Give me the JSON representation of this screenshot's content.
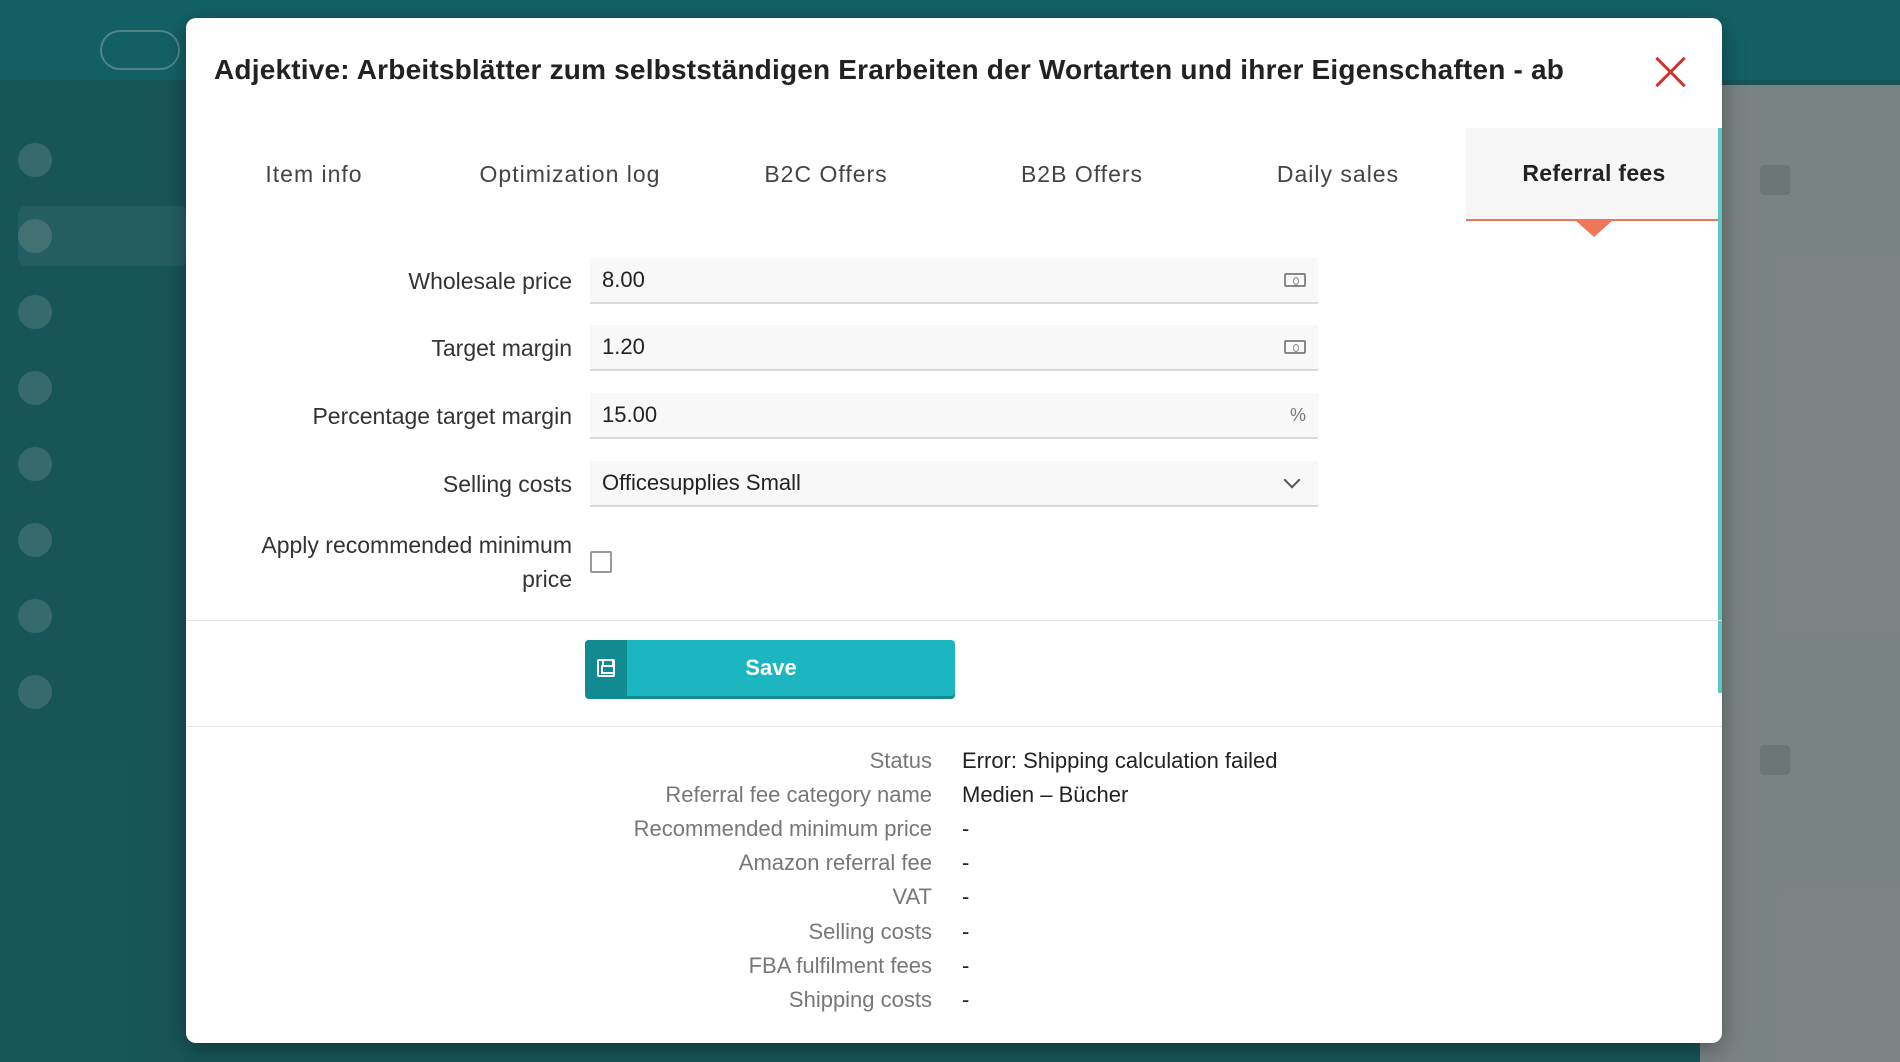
{
  "modal": {
    "title": "Adjektive: Arbeitsblätter zum selbstständigen Erarbeiten der Wortarten und ihrer Eigenschaften - ab"
  },
  "tabs": [
    {
      "label": "Item info",
      "active": false
    },
    {
      "label": "Optimization log",
      "active": false
    },
    {
      "label": "B2C Offers",
      "active": false
    },
    {
      "label": "B2B Offers",
      "active": false
    },
    {
      "label": "Daily sales",
      "active": false
    },
    {
      "label": "Referral fees",
      "active": true
    }
  ],
  "form": {
    "wholesale_price": {
      "label": "Wholesale price",
      "value": "8.00",
      "icon": "money-icon"
    },
    "target_margin": {
      "label": "Target margin",
      "value": "1.20",
      "icon": "money-icon"
    },
    "percentage_target_margin": {
      "label": "Percentage target margin",
      "value": "15.00",
      "suffix": "%"
    },
    "selling_costs": {
      "label": "Selling costs",
      "value": "Officesupplies Small",
      "icon": "chevron-down-icon"
    },
    "apply_min_price": {
      "label_line1": "Apply recommended minimum",
      "label_line2": "price",
      "checked": false
    }
  },
  "save": {
    "label": "Save",
    "icon": "floppy-disk-icon"
  },
  "details": [
    {
      "key": "Status",
      "value": "Error: Shipping calculation failed"
    },
    {
      "key": "Referral fee category name",
      "value": "Medien – Bücher"
    },
    {
      "key": "Recommended minimum price",
      "value": "-"
    },
    {
      "key": "Amazon referral fee",
      "value": "-"
    },
    {
      "key": "VAT",
      "value": "-"
    },
    {
      "key": "Selling costs",
      "value": "-"
    },
    {
      "key": "FBA fulfilment fees",
      "value": "-"
    },
    {
      "key": "Shipping costs",
      "value": "-"
    }
  ],
  "colors": {
    "accent": "#1bb6c0",
    "tab_indicator": "#f0765a",
    "close": "#d0342c"
  }
}
